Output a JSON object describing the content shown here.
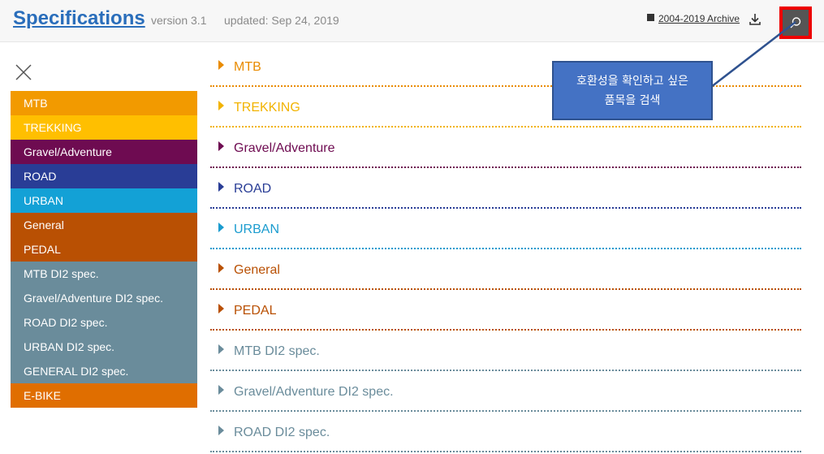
{
  "header": {
    "title": "Specifications",
    "version": "version 3.1",
    "updated": "updated: Sep 24, 2019",
    "archive_label": "2004-2019 Archive"
  },
  "sidebar": {
    "items": [
      {
        "label": "MTB",
        "color": "#f29a00"
      },
      {
        "label": "TREKKING",
        "color": "#ffbf00"
      },
      {
        "label": "Gravel/Adventure",
        "color": "#6e0b51"
      },
      {
        "label": "ROAD",
        "color": "#293d96"
      },
      {
        "label": "URBAN",
        "color": "#13a1d6"
      },
      {
        "label": "General",
        "color": "#b95003"
      },
      {
        "label": "PEDAL",
        "color": "#b95003"
      },
      {
        "label": "MTB DI2 spec.",
        "color": "#6a8c9b"
      },
      {
        "label": "Gravel/Adventure DI2 spec.",
        "color": "#6a8c9b"
      },
      {
        "label": "ROAD DI2 spec.",
        "color": "#6a8c9b"
      },
      {
        "label": "URBAN DI2 spec.",
        "color": "#6a8c9b"
      },
      {
        "label": "GENERAL DI2 spec.",
        "color": "#6a8c9b"
      },
      {
        "label": "E-BIKE",
        "color": "#e06e00"
      }
    ]
  },
  "main": {
    "items": [
      {
        "label": "MTB",
        "color": "#e98b00"
      },
      {
        "label": "TREKKING",
        "color": "#f2b300"
      },
      {
        "label": "Gravel/Adventure",
        "color": "#6e0b51"
      },
      {
        "label": "ROAD",
        "color": "#293d96"
      },
      {
        "label": "URBAN",
        "color": "#1b9ccf"
      },
      {
        "label": "General",
        "color": "#b95003"
      },
      {
        "label": "PEDAL",
        "color": "#b95003"
      },
      {
        "label": "MTB DI2 spec.",
        "color": "#6a8c9b"
      },
      {
        "label": "Gravel/Adventure DI2 spec.",
        "color": "#6a8c9b"
      },
      {
        "label": "ROAD DI2 spec.",
        "color": "#6a8c9b"
      }
    ]
  },
  "callout": {
    "line1": "호환성을 확인하고 싶은",
    "line2": "품목을 검색"
  },
  "icons": {
    "search": "search-icon",
    "close": "close-icon",
    "download": "download-icon",
    "archive": "archive-icon"
  }
}
